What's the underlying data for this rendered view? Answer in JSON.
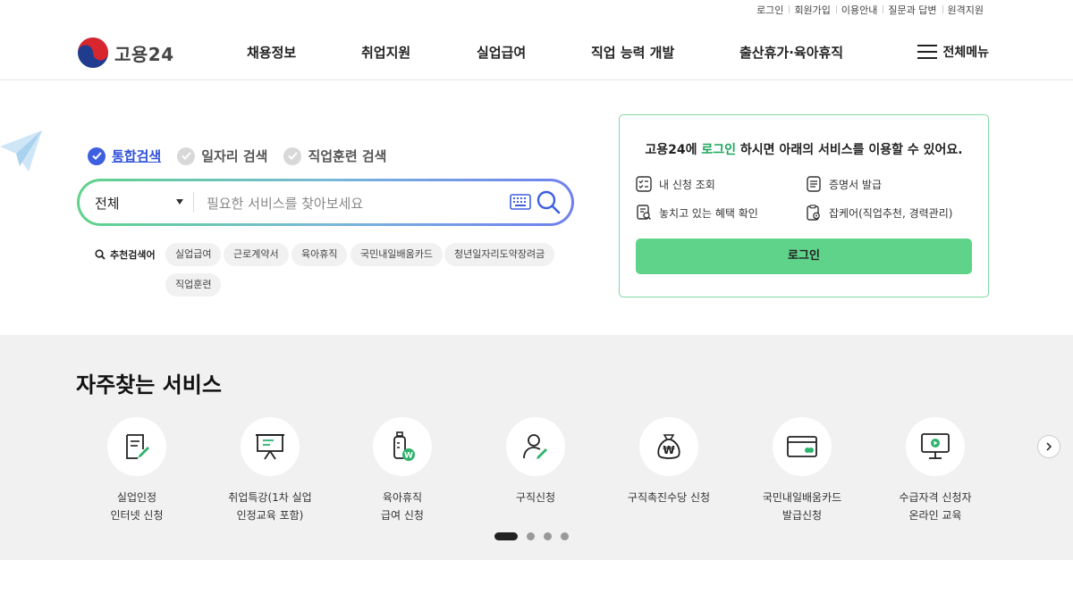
{
  "util_links": [
    "로그인",
    "회원가입",
    "이용안내",
    "질문과 답변",
    "원격지원"
  ],
  "logo_text": "고용24",
  "gnb": [
    "채용정보",
    "취업지원",
    "실업급여",
    "직업 능력 개발",
    "출산휴가·육아휴직"
  ],
  "all_menu": "전체메뉴",
  "search_tabs": [
    {
      "label": "통합검색",
      "selected": true
    },
    {
      "label": "일자리 검색",
      "selected": false
    },
    {
      "label": "직업훈련 검색",
      "selected": false
    }
  ],
  "search": {
    "category": "전체",
    "placeholder": "필요한 서비스를 찾아보세요"
  },
  "recommended": {
    "label": "추천검색어",
    "keywords": [
      "실업급여",
      "근로계약서",
      "육아휴직",
      "국민내일배움카드",
      "청년일자리도약장려금",
      "직업훈련"
    ]
  },
  "login_panel": {
    "title_pre": "고용24에 ",
    "title_em": "로그인",
    "title_post": " 하시면 아래의 서비스를 이용할 수 있어요.",
    "items": [
      "내 신청 조회",
      "증명서 발급",
      "놓치고 있는 혜택 확인",
      "잡케어(직업추천, 경력관리)"
    ],
    "button": "로그인",
    "accent": "#5fd38a"
  },
  "services": {
    "title": "자주찾는 서비스",
    "items": [
      {
        "line1": "실업인정",
        "line2": "인터넷 신청",
        "icon": "document-pen-icon"
      },
      {
        "line1": "취업특강(1차 실업",
        "line2": "인정교육 포함)",
        "icon": "lecture-board-icon"
      },
      {
        "line1": "육아휴직",
        "line2": "급여 신청",
        "icon": "baby-bottle-icon"
      },
      {
        "line1": "구직신청",
        "line2": "",
        "icon": "person-pen-icon"
      },
      {
        "line1": "구직촉진수당 신청",
        "line2": "",
        "icon": "money-bag-icon"
      },
      {
        "line1": "국민내일배움카드",
        "line2": "발급신청",
        "icon": "card-icon"
      },
      {
        "line1": "수급자격 신청자",
        "line2": "온라인 교육",
        "icon": "monitor-play-icon"
      }
    ],
    "pagination": {
      "current": 1,
      "total": 4
    }
  }
}
